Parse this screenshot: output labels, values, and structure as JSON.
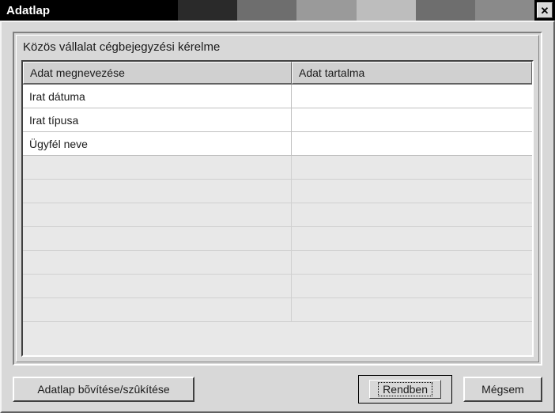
{
  "window": {
    "title": "Adatlap",
    "close_label": "✕"
  },
  "content": {
    "subtitle": "Közös vállalat cégbejegyzési kérelme"
  },
  "table": {
    "headers": {
      "name": "Adat megnevezése",
      "value": "Adat tartalma"
    },
    "rows": [
      {
        "name": "Irat dátuma",
        "value": ""
      },
      {
        "name": "Irat típusa",
        "value": ""
      },
      {
        "name": "Ügyfél neve",
        "value": ""
      }
    ]
  },
  "buttons": {
    "expand": "Adatlap bõvítése/szûkítése",
    "ok": "Rendben",
    "cancel": "Mégsem"
  },
  "gradient_colors": [
    "#000000",
    "#2a2a2a",
    "#6e6e6e",
    "#9a9a9a",
    "#bdbdbd",
    "#6e6e6e",
    "#8a8a8a"
  ]
}
